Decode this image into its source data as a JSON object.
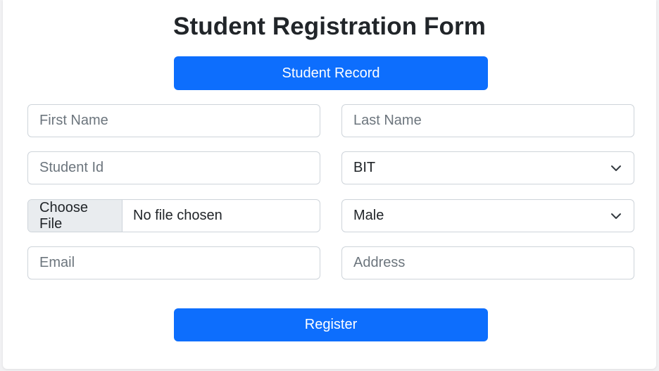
{
  "form": {
    "title": "Student Registration Form",
    "record_button": "Student Record",
    "register_button": "Register",
    "first_name": {
      "placeholder": "First Name",
      "value": ""
    },
    "last_name": {
      "placeholder": "Last Name",
      "value": ""
    },
    "student_id": {
      "placeholder": "Student Id",
      "value": ""
    },
    "program_select": {
      "selected": "BIT"
    },
    "file_input": {
      "button_label": "Choose File",
      "status": "No file chosen"
    },
    "gender_select": {
      "selected": "Male"
    },
    "email": {
      "placeholder": "Email",
      "value": ""
    },
    "address": {
      "placeholder": "Address",
      "value": ""
    }
  },
  "colors": {
    "primary": "#0d6efd",
    "border": "#ced4da",
    "placeholder": "#6c757d",
    "file_button_bg": "#e9ecef"
  }
}
